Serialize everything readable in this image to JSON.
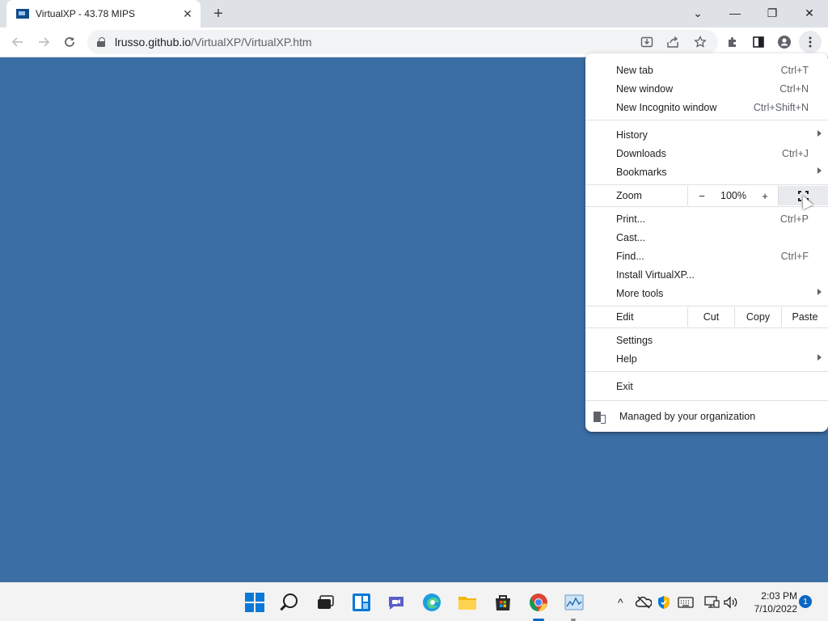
{
  "tab": {
    "title": "VirtualXP - 43.78 MIPS",
    "close": "✕"
  },
  "newtab": "+",
  "window_controls": {
    "tabsearch": "⌄",
    "minimize": "—",
    "restore": "❐",
    "close": "✕"
  },
  "address": {
    "host": "lrusso.github.io",
    "path": "/VirtualXP/VirtualXP.htm"
  },
  "menu": {
    "items_top": [
      {
        "label": "New tab",
        "accel": "Ctrl+T"
      },
      {
        "label": "New window",
        "accel": "Ctrl+N"
      },
      {
        "label": "New Incognito window",
        "accel": "Ctrl+Shift+N"
      }
    ],
    "items_nav": [
      {
        "label": "History",
        "accel": ""
      },
      {
        "label": "Downloads",
        "accel": "Ctrl+J"
      },
      {
        "label": "Bookmarks",
        "accel": ""
      }
    ],
    "zoom": {
      "label": "Zoom",
      "minus": "−",
      "value": "100%",
      "plus": "+"
    },
    "items_tools": [
      {
        "label": "Print...",
        "accel": "Ctrl+P"
      },
      {
        "label": "Cast...",
        "accel": ""
      },
      {
        "label": "Find...",
        "accel": "Ctrl+F"
      },
      {
        "label": "Install VirtualXP...",
        "accel": ""
      },
      {
        "label": "More tools",
        "accel": ""
      }
    ],
    "edit": {
      "label": "Edit",
      "cut": "Cut",
      "copy": "Copy",
      "paste": "Paste"
    },
    "items_settings": [
      {
        "label": "Settings",
        "accel": ""
      },
      {
        "label": "Help",
        "accel": ""
      }
    ],
    "exit": "Exit",
    "managed": "Managed by your organization"
  },
  "taskbar": {
    "clock_time": "2:03 PM",
    "clock_date": "7/10/2022",
    "notifications": "1",
    "tray_arrow": "^"
  }
}
